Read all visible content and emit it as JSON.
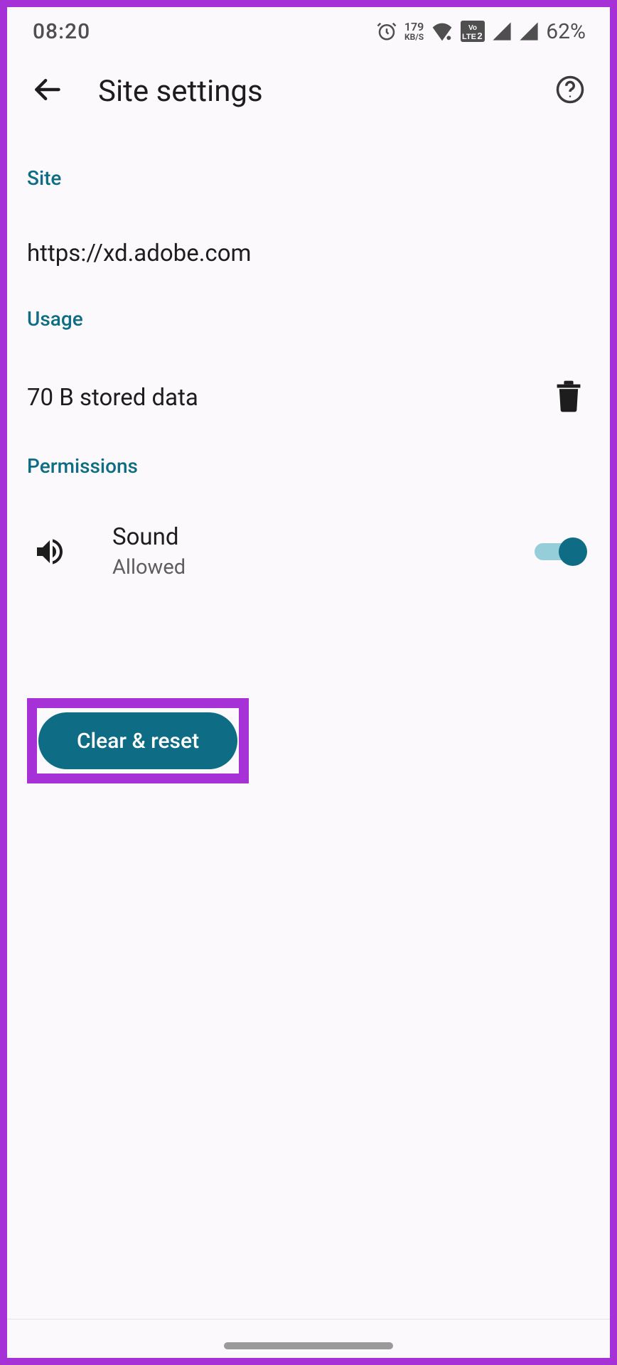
{
  "status": {
    "time": "08:20",
    "net_top": "179",
    "net_bot": "KB/S",
    "battery_pct": "62%"
  },
  "header": {
    "title": "Site settings"
  },
  "sections": {
    "site_label": "Site",
    "site_url": "https://xd.adobe.com",
    "usage_label": "Usage",
    "usage_text": "70 B stored data",
    "permissions_label": "Permissions"
  },
  "permission": {
    "title": "Sound",
    "subtitle": "Allowed",
    "enabled": true
  },
  "buttons": {
    "clear_reset": "Clear & reset"
  },
  "colors": {
    "accent": "#0e6d84",
    "highlight": "#a631d6"
  }
}
